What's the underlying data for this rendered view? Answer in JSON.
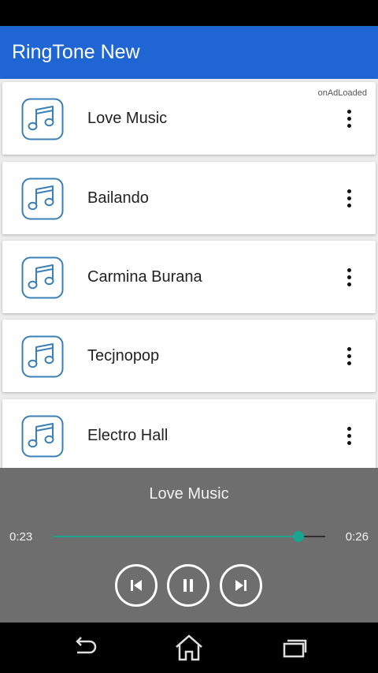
{
  "app": {
    "title": "RingTone New"
  },
  "ad": {
    "label": "onAdLoaded"
  },
  "songs": [
    {
      "title": "Love Music"
    },
    {
      "title": "Bailando"
    },
    {
      "title": "Carmina Burana"
    },
    {
      "title": "Tecjnopop"
    },
    {
      "title": "Electro Hall"
    }
  ],
  "player": {
    "now_playing": "Love Music",
    "current_time": "0:23",
    "duration": "0:26",
    "progress": 0.903
  },
  "colors": {
    "app_bar": "#1f66d4",
    "accent": "#1aa592",
    "icon": "#3a7fb5",
    "player_bg": "#6e6e6e"
  },
  "icons": {
    "song": "music-note-icon",
    "menu": "more-vert-icon",
    "prev": "skip-previous-icon",
    "pause": "pause-icon",
    "next": "skip-next-icon",
    "back": "back-icon",
    "home": "home-icon",
    "recents": "recents-icon"
  }
}
